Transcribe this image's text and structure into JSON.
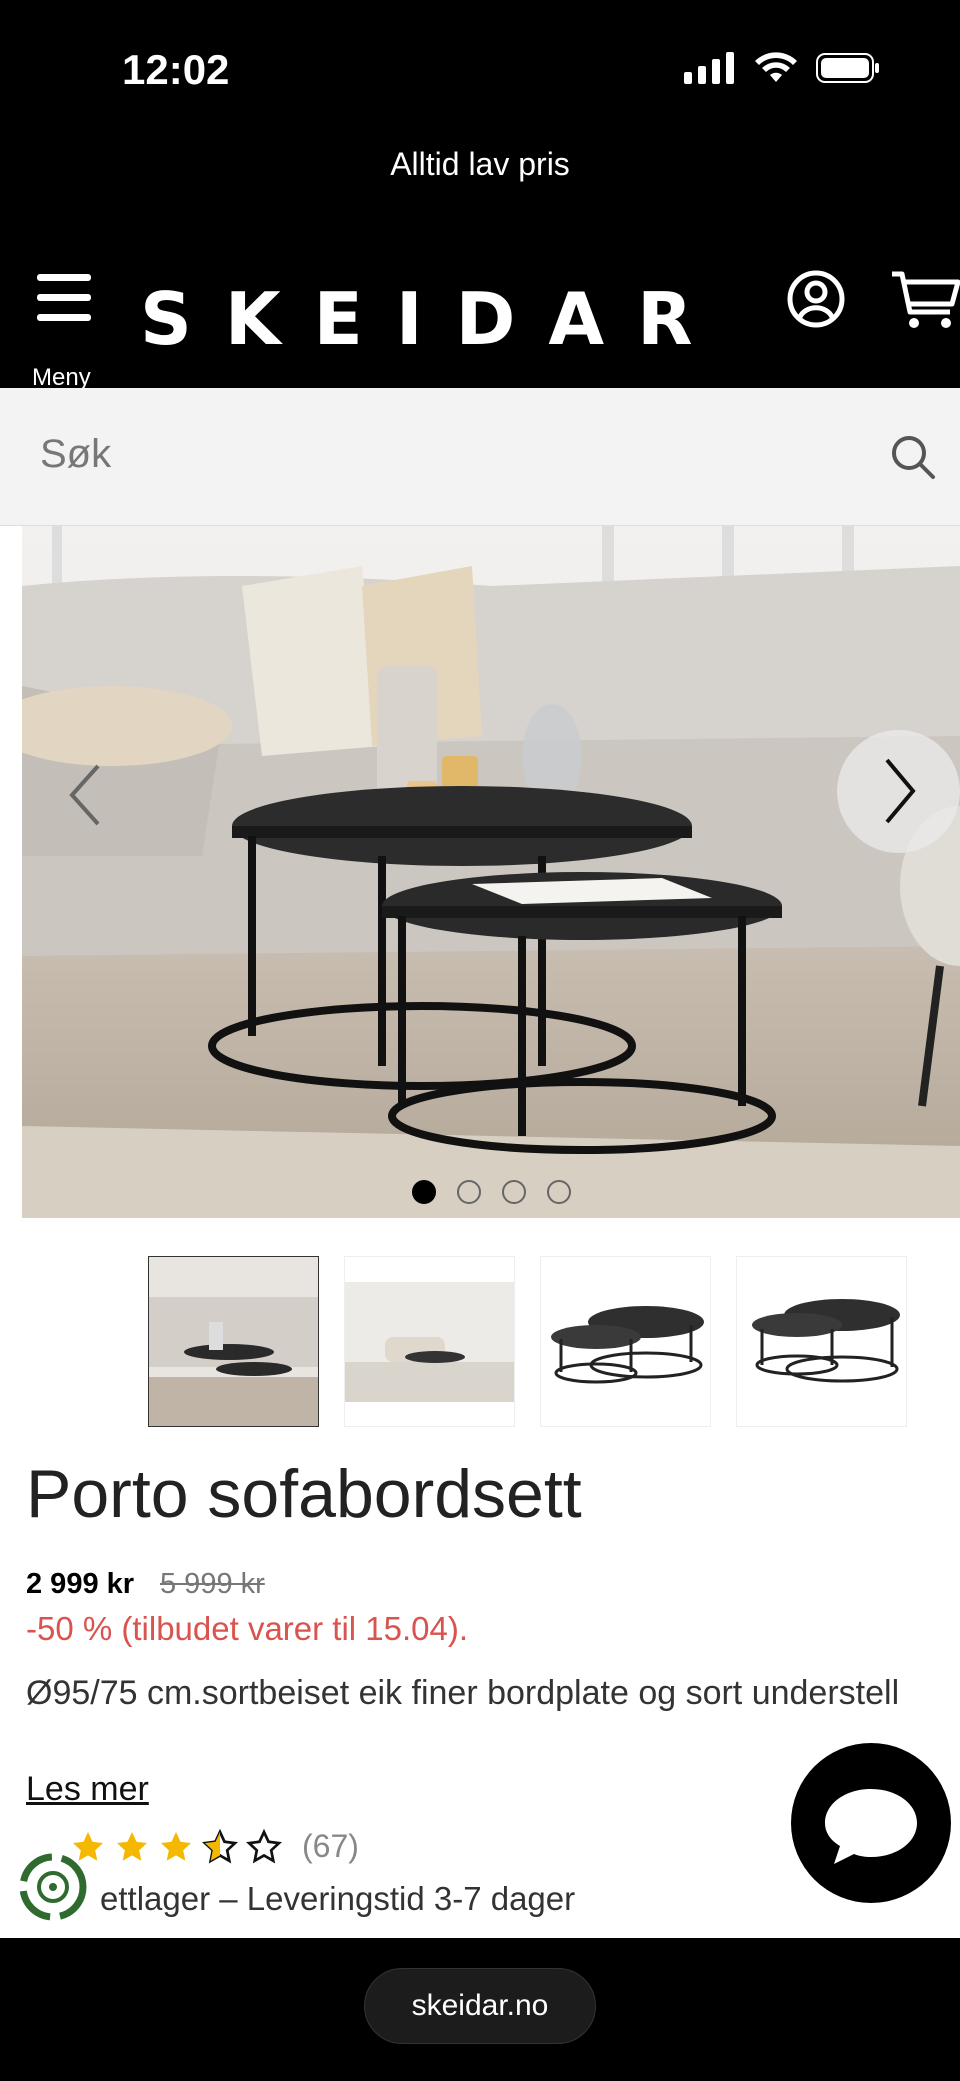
{
  "status_bar": {
    "time": "12:02"
  },
  "promo_banner": {
    "text": "Alltid lav pris"
  },
  "header": {
    "menu_label": "Meny",
    "logo": "SKEIDAR"
  },
  "search": {
    "placeholder": "Søk"
  },
  "gallery": {
    "image_count": 4,
    "active_index": 0,
    "thumbnails": [
      "thumb-1",
      "thumb-2",
      "thumb-3",
      "thumb-4"
    ]
  },
  "product": {
    "title": "Porto sofabordsett",
    "price": "2 999 kr",
    "old_price": "5 999 kr",
    "discount": "-50 % (tilbudet varer til 15.04).",
    "description": "Ø95/75 cm.sortbeiset eik finer bordplate og sort understell",
    "read_more": "Les mer",
    "rating": 3.5,
    "review_count": "(67)",
    "stock": "ettlager – Leveringstid 3-7 dager"
  },
  "footer": {
    "url": "skeidar.no"
  },
  "colors": {
    "discount": "#d9534f",
    "star": "#f5b800",
    "header_bg": "#000000"
  }
}
